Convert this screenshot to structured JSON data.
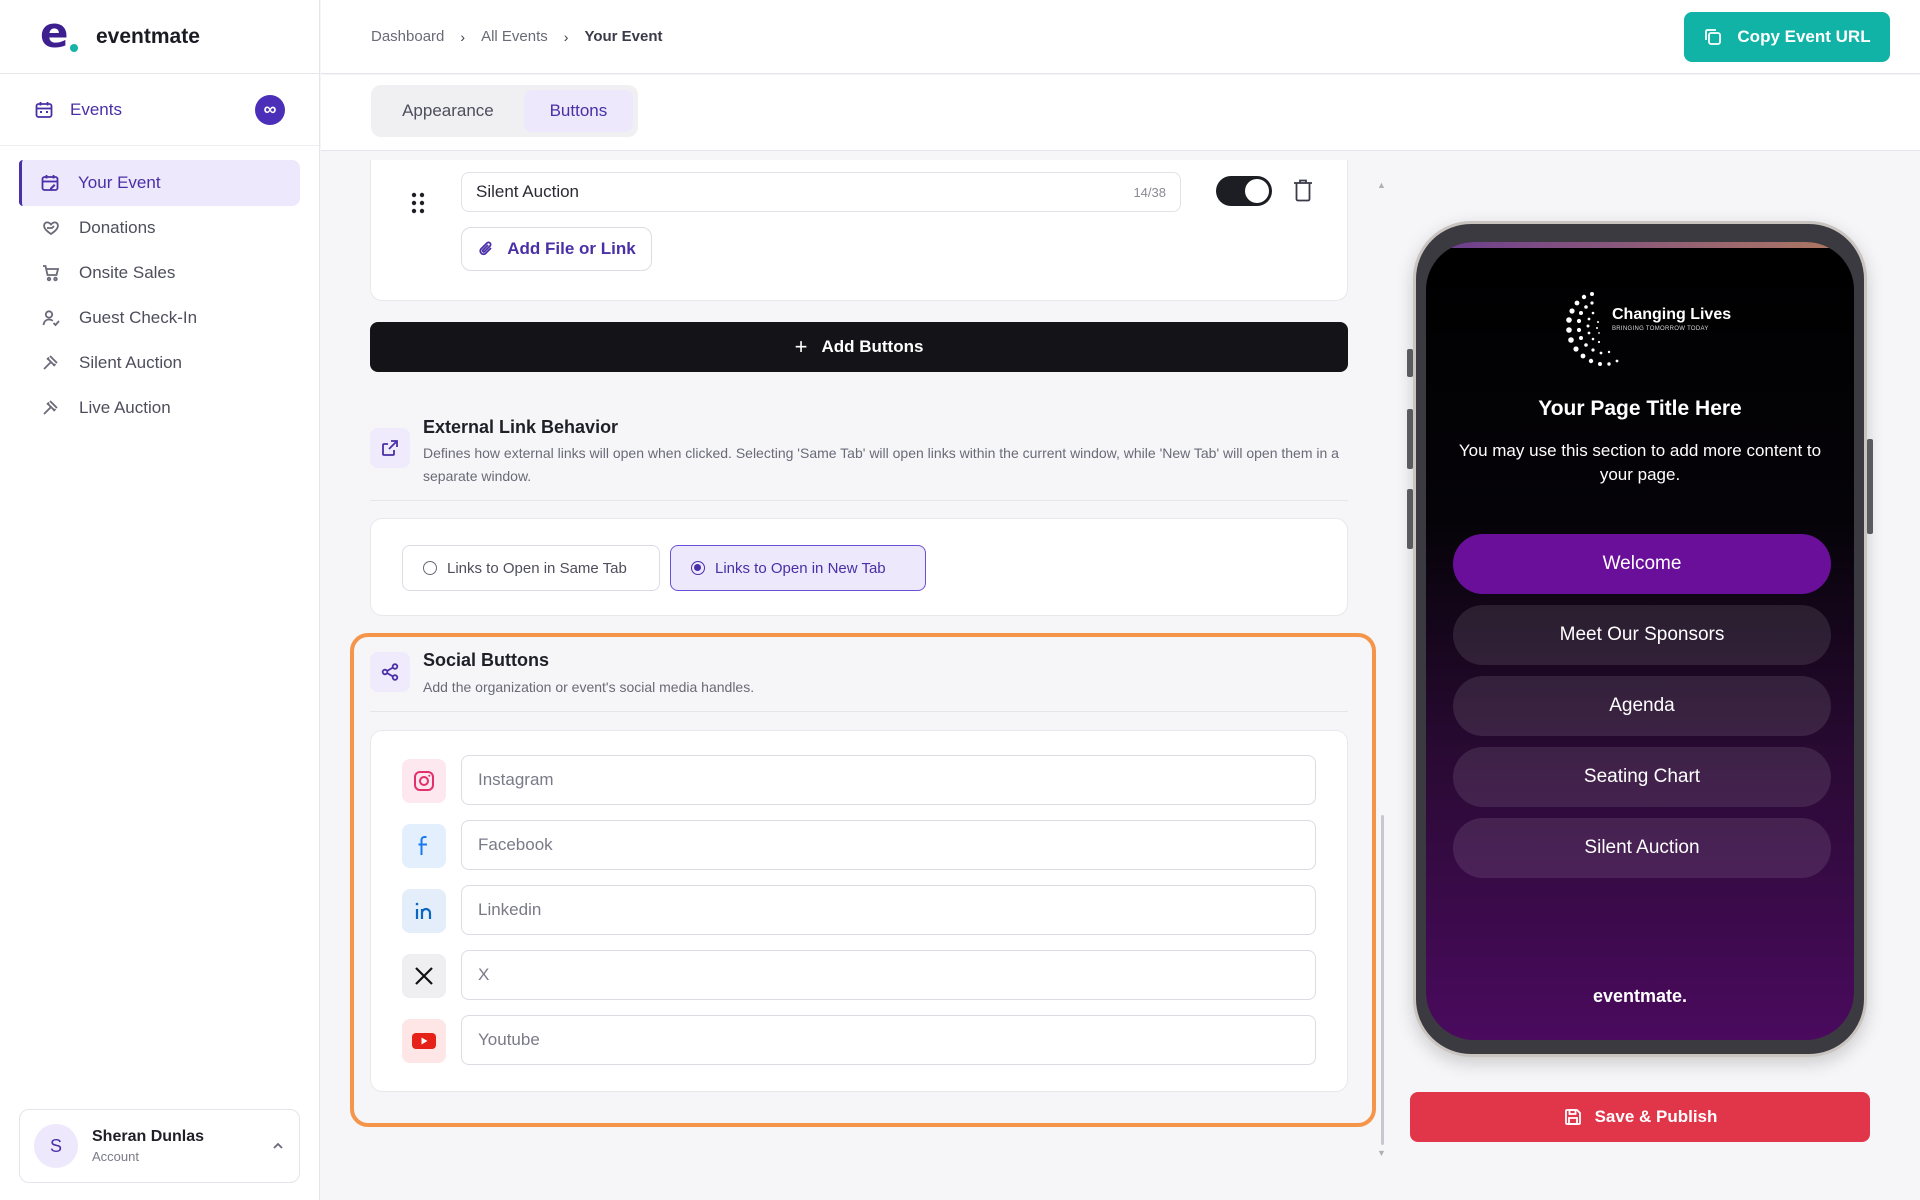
{
  "brand": {
    "name": "eventmate"
  },
  "sidebar": {
    "events_label": "Events",
    "events_badge": "∞",
    "items": [
      {
        "label": "Your Event",
        "active": true
      },
      {
        "label": "Donations"
      },
      {
        "label": "Onsite Sales"
      },
      {
        "label": "Guest Check-In"
      },
      {
        "label": "Silent Auction"
      },
      {
        "label": "Live Auction"
      }
    ],
    "account": {
      "initial": "S",
      "name": "Sheran Dunlas",
      "role": "Account"
    }
  },
  "breadcrumb": [
    "Dashboard",
    "All Events",
    "Your Event"
  ],
  "header": {
    "copy_url_label": "Copy Event URL"
  },
  "tabs": [
    {
      "label": "Appearance",
      "active": false
    },
    {
      "label": "Buttons",
      "active": true
    }
  ],
  "button_item": {
    "name": "Silent Auction",
    "char_count": "14/38",
    "enabled": true,
    "add_file_label": "Add File or Link"
  },
  "add_buttons_label": "Add Buttons",
  "external_link": {
    "title": "External Link Behavior",
    "description": "Defines how external links will open when clicked. Selecting 'Same Tab' will open links within the current window, while 'New Tab' will open them in a separate window.",
    "options": [
      {
        "label": "Links to Open in Same Tab",
        "selected": false
      },
      {
        "label": "Links to Open in New Tab",
        "selected": true
      }
    ]
  },
  "social": {
    "title": "Social Buttons",
    "description": "Add the organization or event's social media handles.",
    "fields": [
      {
        "icon": "instagram-icon",
        "placeholder": "Instagram",
        "color": "#e1306c",
        "bg": "#fde8ef"
      },
      {
        "icon": "facebook-icon",
        "placeholder": "Facebook",
        "color": "#1877f2",
        "bg": "#e4effd"
      },
      {
        "icon": "linkedin-icon",
        "placeholder": "Linkedin",
        "color": "#0a66c2",
        "bg": "#e3eefa"
      },
      {
        "icon": "x-icon",
        "placeholder": "X",
        "color": "#111111",
        "bg": "#efeff2"
      },
      {
        "icon": "youtube-icon",
        "placeholder": "Youtube",
        "color": "#e62117",
        "bg": "#fde6e5"
      }
    ]
  },
  "preview": {
    "logo_title": "Changing Lives",
    "logo_subtitle": "BRINGING TOMORROW TODAY",
    "page_title": "Your Page Title Here",
    "page_subtitle": "You may use this section to add more content to your page.",
    "buttons": [
      "Welcome",
      "Meet Our Sponsors",
      "Agenda",
      "Seating Chart",
      "Silent Auction"
    ],
    "footer_brand": "eventmate."
  },
  "save_label": "Save & Publish",
  "colors": {
    "accent": "#4a2fa6",
    "teal": "#10b3a5",
    "save": "#e1354a",
    "highlight": "#f4954a"
  }
}
